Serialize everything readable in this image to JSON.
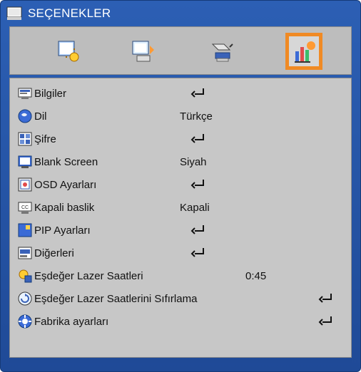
{
  "window": {
    "title": "SEÇENEKLER"
  },
  "tabs": [
    {
      "name": "tab-image"
    },
    {
      "name": "tab-screen"
    },
    {
      "name": "tab-settings"
    },
    {
      "name": "tab-options",
      "selected": true
    }
  ],
  "menu": {
    "items": [
      {
        "label": "Bilgiler",
        "value": "",
        "enter": true
      },
      {
        "label": "Dil",
        "value": "Türkçe",
        "enter": false
      },
      {
        "label": "Şifre",
        "value": "",
        "enter": true
      },
      {
        "label": "Blank Screen",
        "value": "Siyah",
        "enter": false
      },
      {
        "label": "OSD Ayarları",
        "value": "",
        "enter": true
      },
      {
        "label": "Kapali baslik",
        "value": "Kapali",
        "enter": false
      },
      {
        "label": "PIP Ayarları",
        "value": "",
        "enter": true
      },
      {
        "label": "Diğerleri",
        "value": "",
        "enter": true
      },
      {
        "label": "Eşdeğer Lazer Saatleri",
        "value": "0:45",
        "enter": false
      },
      {
        "label": "Eşdeğer Lazer Saatlerini Sıfırlama",
        "value": "",
        "enter": true
      },
      {
        "label": "Fabrika ayarları",
        "value": "",
        "enter": true
      }
    ]
  },
  "colors": {
    "frame_blue": "#2c5fb4",
    "panel_gray": "#c7c7c7",
    "selection_orange": "#f08a24"
  }
}
